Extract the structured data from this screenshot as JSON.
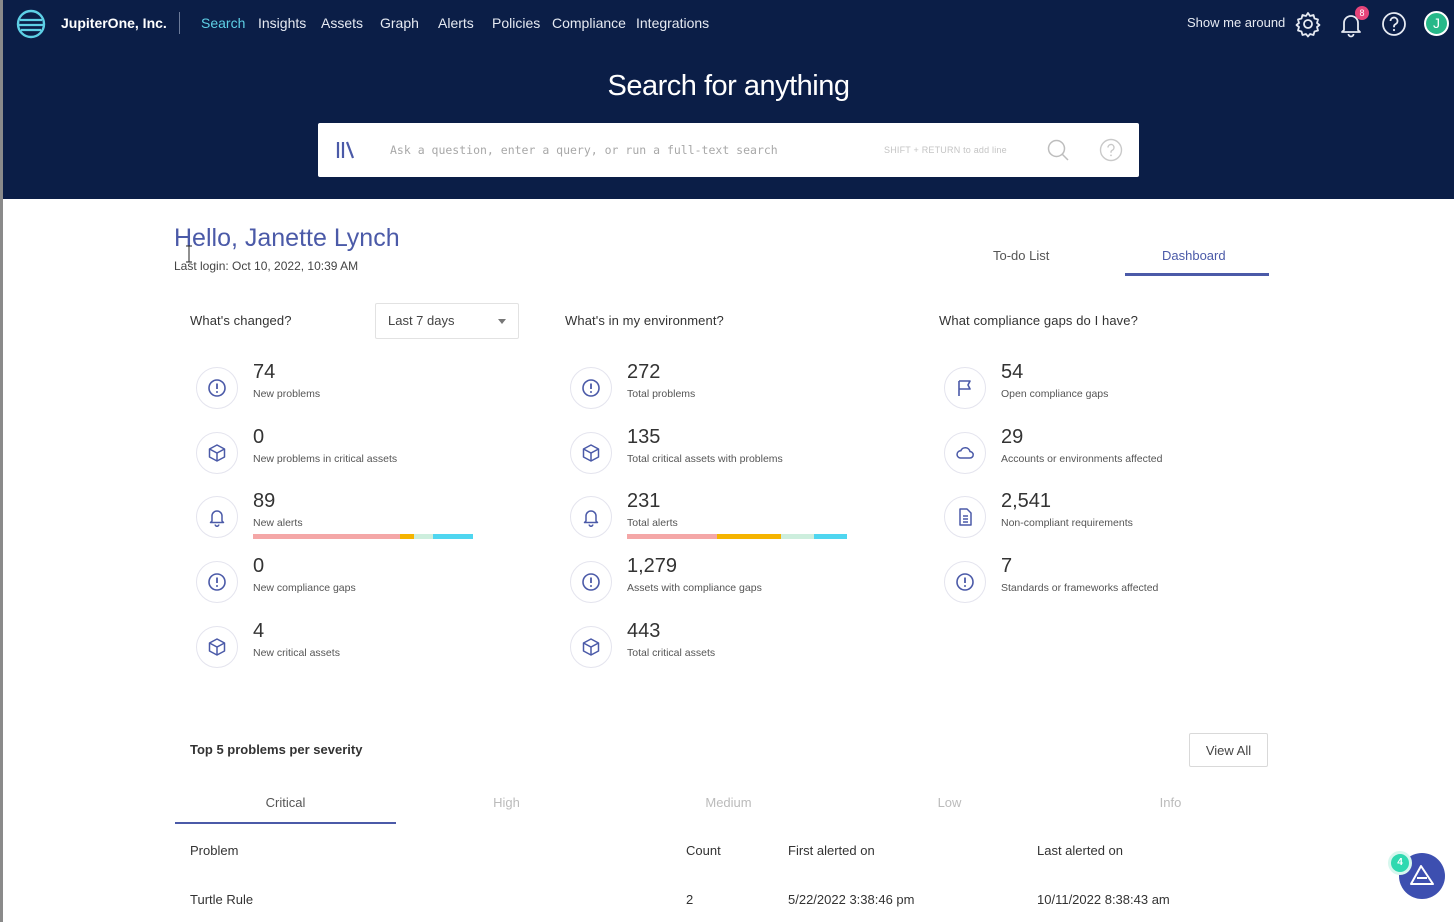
{
  "header": {
    "org_name": "JupiterOne, Inc.",
    "nav": [
      {
        "label": "Search",
        "active": true
      },
      {
        "label": "Insights",
        "active": false
      },
      {
        "label": "Assets",
        "active": false
      },
      {
        "label": "Graph",
        "active": false
      },
      {
        "label": "Alerts",
        "active": false
      },
      {
        "label": "Policies",
        "active": false
      },
      {
        "label": "Compliance",
        "active": false
      },
      {
        "label": "Integrations",
        "active": false
      }
    ],
    "show_me_around": "Show me around",
    "notification_count": "8",
    "avatar_initial": "J",
    "bg_color": "#0b1e47",
    "active_color": "#5ed0e6"
  },
  "hero": {
    "title": "Search for anything",
    "search_placeholder": "Ask a question, enter a query, or run a full-text search",
    "shift_hint": "SHIFT + RETURN to add line"
  },
  "greeting": {
    "title": "Hello, Janette Lynch",
    "last_login": "Last login:  Oct 10, 2022, 10:39 AM"
  },
  "view_tabs": [
    {
      "label": "To-do List",
      "active": false
    },
    {
      "label": "Dashboard",
      "active": true
    }
  ],
  "changed": {
    "title": "What's changed?",
    "range": "Last 7 days",
    "metrics": [
      {
        "icon": "alert-circle-icon",
        "value": "74",
        "label": "New problems"
      },
      {
        "icon": "cube-icon",
        "value": "0",
        "label": "New problems in critical assets"
      },
      {
        "icon": "bell-icon",
        "value": "89",
        "label": "New alerts",
        "severity_bar": [
          0.67,
          0.06,
          0.09,
          0.18
        ]
      },
      {
        "icon": "alert-circle-icon",
        "value": "0",
        "label": "New compliance gaps"
      },
      {
        "icon": "cube-icon",
        "value": "4",
        "label": "New critical assets"
      }
    ]
  },
  "environment": {
    "title": "What's in my environment?",
    "metrics": [
      {
        "icon": "alert-circle-icon",
        "value": "272",
        "label": "Total problems"
      },
      {
        "icon": "cube-icon",
        "value": "135",
        "label": "Total critical assets with problems"
      },
      {
        "icon": "bell-icon",
        "value": "231",
        "label": "Total alerts",
        "severity_bar": [
          0.41,
          0.29,
          0.15,
          0.15
        ]
      },
      {
        "icon": "alert-circle-icon",
        "value": "1,279",
        "label": "Assets with compliance gaps"
      },
      {
        "icon": "cube-icon",
        "value": "443",
        "label": "Total critical assets"
      }
    ]
  },
  "compliance": {
    "title": "What compliance gaps do I have?",
    "metrics": [
      {
        "icon": "flag-icon",
        "value": "54",
        "label": "Open compliance gaps"
      },
      {
        "icon": "cloud-icon",
        "value": "29",
        "label": "Accounts or environments affected"
      },
      {
        "icon": "document-icon",
        "value": "2,541",
        "label": "Non-compliant requirements"
      },
      {
        "icon": "alert-circle-icon",
        "value": "7",
        "label": "Standards or frameworks affected"
      }
    ]
  },
  "severity_colors": [
    "#f4a7a7",
    "#f5b400",
    "#cdeedd",
    "#4fd6f0"
  ],
  "top5": {
    "title": "Top 5 problems per severity",
    "view_all": "View All",
    "tabs": [
      {
        "label": "Critical",
        "active": true
      },
      {
        "label": "High",
        "active": false
      },
      {
        "label": "Medium",
        "active": false
      },
      {
        "label": "Low",
        "active": false
      },
      {
        "label": "Info",
        "active": false
      }
    ],
    "columns": [
      "Problem",
      "Count",
      "First alerted on",
      "Last alerted on"
    ],
    "rows": [
      [
        "Turtle Rule",
        "2",
        "5/22/2022 3:38:46 pm",
        "10/11/2022 8:38:43 am"
      ]
    ]
  },
  "assistant": {
    "badge": "4"
  }
}
